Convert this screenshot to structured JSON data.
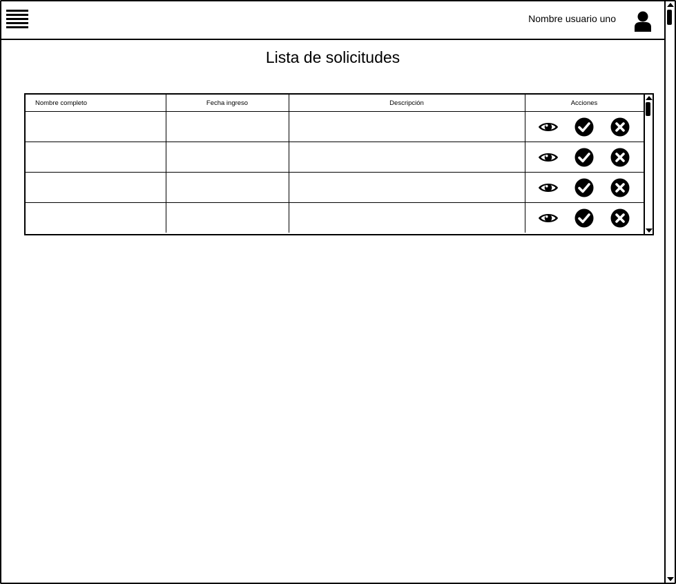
{
  "header": {
    "username": "Nombre usuario uno",
    "menu_icon": "hamburger-menu-icon",
    "user_icon": "user-icon"
  },
  "page": {
    "title": "Lista de solicitudes"
  },
  "table": {
    "columns": [
      "Nombre completo",
      "Fecha ingreso",
      "Descripción",
      "Acciones"
    ],
    "rows": [
      {
        "nombre": "",
        "fecha": "",
        "descripcion": ""
      },
      {
        "nombre": "",
        "fecha": "",
        "descripcion": ""
      },
      {
        "nombre": "",
        "fecha": "",
        "descripcion": ""
      },
      {
        "nombre": "",
        "fecha": "",
        "descripcion": ""
      }
    ],
    "action_icons": [
      "eye-icon",
      "check-circle-icon",
      "close-circle-icon"
    ]
  }
}
